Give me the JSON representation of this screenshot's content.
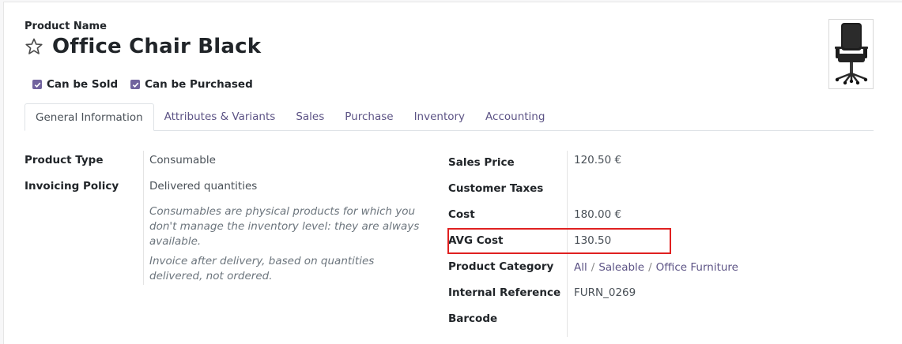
{
  "header": {
    "name_label": "Product Name",
    "product_name": "Office Chair Black",
    "favorite_icon": "star-icon",
    "checkboxes": [
      {
        "label": "Can be Sold",
        "checked": true
      },
      {
        "label": "Can be Purchased",
        "checked": true
      }
    ],
    "image_alt": "office-chair-image"
  },
  "tabs": [
    {
      "label": "General Information",
      "active": true
    },
    {
      "label": "Attributes & Variants"
    },
    {
      "label": "Sales"
    },
    {
      "label": "Purchase"
    },
    {
      "label": "Inventory"
    },
    {
      "label": "Accounting"
    }
  ],
  "left": {
    "product_type_label": "Product Type",
    "product_type_value": "Consumable",
    "invoicing_policy_label": "Invoicing Policy",
    "invoicing_policy_value": "Delivered quantities",
    "help_1": "Consumables are physical products for which you don't manage the inventory level: they are always available.",
    "help_2": "Invoice after delivery, based on quantities delivered, not ordered."
  },
  "right": {
    "sales_price_label": "Sales Price",
    "sales_price_value": "120.50 €",
    "customer_taxes_label": "Customer Taxes",
    "customer_taxes_value": "",
    "cost_label": "Cost",
    "cost_value": "180.00 €",
    "avg_cost_label": "AVG Cost",
    "avg_cost_value": "130.50",
    "product_category_label": "Product Category",
    "product_category_path": [
      "All",
      "Saleable",
      "Office Furniture"
    ],
    "product_category_sep": "/",
    "internal_reference_label": "Internal Reference",
    "internal_reference_value": "FURN_0269",
    "barcode_label": "Barcode",
    "barcode_value": ""
  },
  "colors": {
    "accent": "#71639e",
    "link": "#5c5385",
    "highlight": "#e02020"
  }
}
